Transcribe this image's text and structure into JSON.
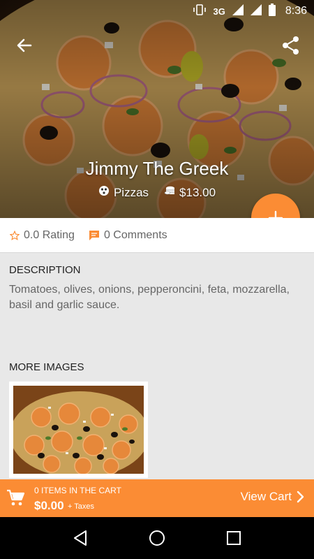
{
  "status_bar": {
    "network": "3G",
    "time": "8:36"
  },
  "item": {
    "name": "Jimmy The Greek",
    "category": "Pizzas",
    "price": "$13.00"
  },
  "stats": {
    "rating": "0.0 Rating",
    "comments": "0 Comments"
  },
  "description": {
    "heading": "DESCRIPTION",
    "text": "Tomatoes, olives, onions, pepperoncini, feta, mozzarella, basil and garlic sauce."
  },
  "more_images": {
    "heading": "MORE IMAGES"
  },
  "cart": {
    "items_label": "0 ITEMS IN THE CART",
    "total": "$0.00",
    "taxes": "+ Taxes",
    "view_cart": "View Cart"
  },
  "colors": {
    "accent": "#fb8c34",
    "background": "#e8e8e8"
  },
  "icons": [
    "back-arrow-icon",
    "share-icon",
    "pizza-icon",
    "coins-icon",
    "plus-icon",
    "star-outline-icon",
    "comment-icon",
    "cart-icon",
    "chevron-right-icon",
    "nav-back-icon",
    "nav-home-icon",
    "nav-recents-icon"
  ]
}
